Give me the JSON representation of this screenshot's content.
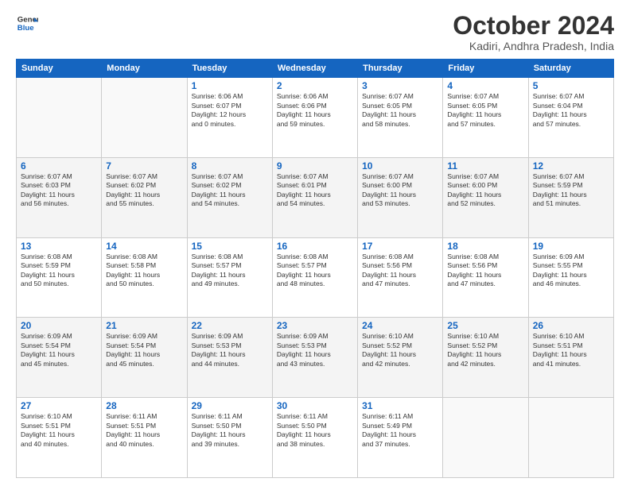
{
  "logo": {
    "line1": "General",
    "line2": "Blue"
  },
  "title": "October 2024",
  "location": "Kadiri, Andhra Pradesh, India",
  "days_of_week": [
    "Sunday",
    "Monday",
    "Tuesday",
    "Wednesday",
    "Thursday",
    "Friday",
    "Saturday"
  ],
  "weeks": [
    [
      {
        "day": "",
        "info": ""
      },
      {
        "day": "",
        "info": ""
      },
      {
        "day": "1",
        "info": "Sunrise: 6:06 AM\nSunset: 6:07 PM\nDaylight: 12 hours\nand 0 minutes."
      },
      {
        "day": "2",
        "info": "Sunrise: 6:06 AM\nSunset: 6:06 PM\nDaylight: 11 hours\nand 59 minutes."
      },
      {
        "day": "3",
        "info": "Sunrise: 6:07 AM\nSunset: 6:05 PM\nDaylight: 11 hours\nand 58 minutes."
      },
      {
        "day": "4",
        "info": "Sunrise: 6:07 AM\nSunset: 6:05 PM\nDaylight: 11 hours\nand 57 minutes."
      },
      {
        "day": "5",
        "info": "Sunrise: 6:07 AM\nSunset: 6:04 PM\nDaylight: 11 hours\nand 57 minutes."
      }
    ],
    [
      {
        "day": "6",
        "info": "Sunrise: 6:07 AM\nSunset: 6:03 PM\nDaylight: 11 hours\nand 56 minutes."
      },
      {
        "day": "7",
        "info": "Sunrise: 6:07 AM\nSunset: 6:02 PM\nDaylight: 11 hours\nand 55 minutes."
      },
      {
        "day": "8",
        "info": "Sunrise: 6:07 AM\nSunset: 6:02 PM\nDaylight: 11 hours\nand 54 minutes."
      },
      {
        "day": "9",
        "info": "Sunrise: 6:07 AM\nSunset: 6:01 PM\nDaylight: 11 hours\nand 54 minutes."
      },
      {
        "day": "10",
        "info": "Sunrise: 6:07 AM\nSunset: 6:00 PM\nDaylight: 11 hours\nand 53 minutes."
      },
      {
        "day": "11",
        "info": "Sunrise: 6:07 AM\nSunset: 6:00 PM\nDaylight: 11 hours\nand 52 minutes."
      },
      {
        "day": "12",
        "info": "Sunrise: 6:07 AM\nSunset: 5:59 PM\nDaylight: 11 hours\nand 51 minutes."
      }
    ],
    [
      {
        "day": "13",
        "info": "Sunrise: 6:08 AM\nSunset: 5:59 PM\nDaylight: 11 hours\nand 50 minutes."
      },
      {
        "day": "14",
        "info": "Sunrise: 6:08 AM\nSunset: 5:58 PM\nDaylight: 11 hours\nand 50 minutes."
      },
      {
        "day": "15",
        "info": "Sunrise: 6:08 AM\nSunset: 5:57 PM\nDaylight: 11 hours\nand 49 minutes."
      },
      {
        "day": "16",
        "info": "Sunrise: 6:08 AM\nSunset: 5:57 PM\nDaylight: 11 hours\nand 48 minutes."
      },
      {
        "day": "17",
        "info": "Sunrise: 6:08 AM\nSunset: 5:56 PM\nDaylight: 11 hours\nand 47 minutes."
      },
      {
        "day": "18",
        "info": "Sunrise: 6:08 AM\nSunset: 5:56 PM\nDaylight: 11 hours\nand 47 minutes."
      },
      {
        "day": "19",
        "info": "Sunrise: 6:09 AM\nSunset: 5:55 PM\nDaylight: 11 hours\nand 46 minutes."
      }
    ],
    [
      {
        "day": "20",
        "info": "Sunrise: 6:09 AM\nSunset: 5:54 PM\nDaylight: 11 hours\nand 45 minutes."
      },
      {
        "day": "21",
        "info": "Sunrise: 6:09 AM\nSunset: 5:54 PM\nDaylight: 11 hours\nand 45 minutes."
      },
      {
        "day": "22",
        "info": "Sunrise: 6:09 AM\nSunset: 5:53 PM\nDaylight: 11 hours\nand 44 minutes."
      },
      {
        "day": "23",
        "info": "Sunrise: 6:09 AM\nSunset: 5:53 PM\nDaylight: 11 hours\nand 43 minutes."
      },
      {
        "day": "24",
        "info": "Sunrise: 6:10 AM\nSunset: 5:52 PM\nDaylight: 11 hours\nand 42 minutes."
      },
      {
        "day": "25",
        "info": "Sunrise: 6:10 AM\nSunset: 5:52 PM\nDaylight: 11 hours\nand 42 minutes."
      },
      {
        "day": "26",
        "info": "Sunrise: 6:10 AM\nSunset: 5:51 PM\nDaylight: 11 hours\nand 41 minutes."
      }
    ],
    [
      {
        "day": "27",
        "info": "Sunrise: 6:10 AM\nSunset: 5:51 PM\nDaylight: 11 hours\nand 40 minutes."
      },
      {
        "day": "28",
        "info": "Sunrise: 6:11 AM\nSunset: 5:51 PM\nDaylight: 11 hours\nand 40 minutes."
      },
      {
        "day": "29",
        "info": "Sunrise: 6:11 AM\nSunset: 5:50 PM\nDaylight: 11 hours\nand 39 minutes."
      },
      {
        "day": "30",
        "info": "Sunrise: 6:11 AM\nSunset: 5:50 PM\nDaylight: 11 hours\nand 38 minutes."
      },
      {
        "day": "31",
        "info": "Sunrise: 6:11 AM\nSunset: 5:49 PM\nDaylight: 11 hours\nand 37 minutes."
      },
      {
        "day": "",
        "info": ""
      },
      {
        "day": "",
        "info": ""
      }
    ]
  ]
}
